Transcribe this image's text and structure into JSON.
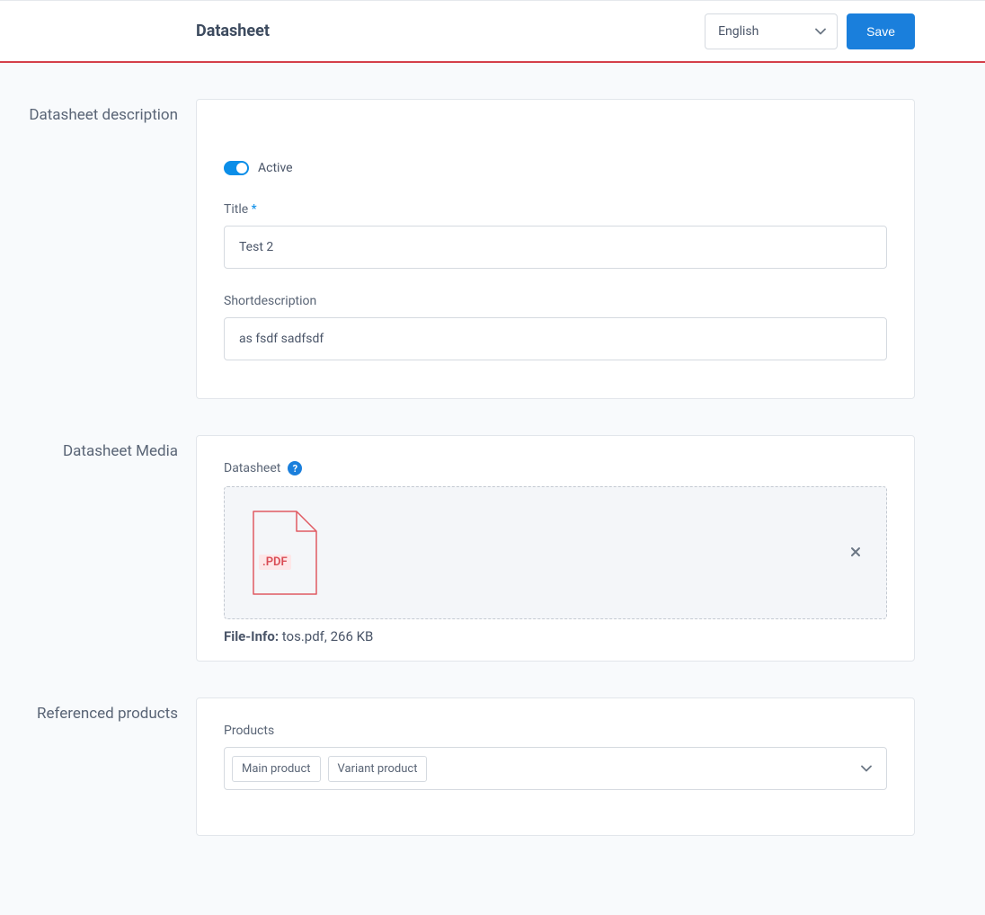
{
  "header": {
    "title": "Datasheet",
    "language": "English",
    "save_label": "Save"
  },
  "sections": {
    "description": {
      "heading": "Datasheet description",
      "active_label": "Active",
      "active_value": true,
      "title_label": "Title",
      "title_value": "Test 2",
      "shortdesc_label": "Shortdescription",
      "shortdesc_value": "as fsdf sadfsdf"
    },
    "media": {
      "heading": "Datasheet Media",
      "field_label": "Datasheet",
      "file_extension": ".PDF",
      "file_info_label": "File-Info:",
      "file_name": "tos.pdf",
      "file_size": "266 KB"
    },
    "products": {
      "heading": "Referenced products",
      "field_label": "Products",
      "selected": [
        "Main product",
        "Variant product"
      ]
    }
  }
}
